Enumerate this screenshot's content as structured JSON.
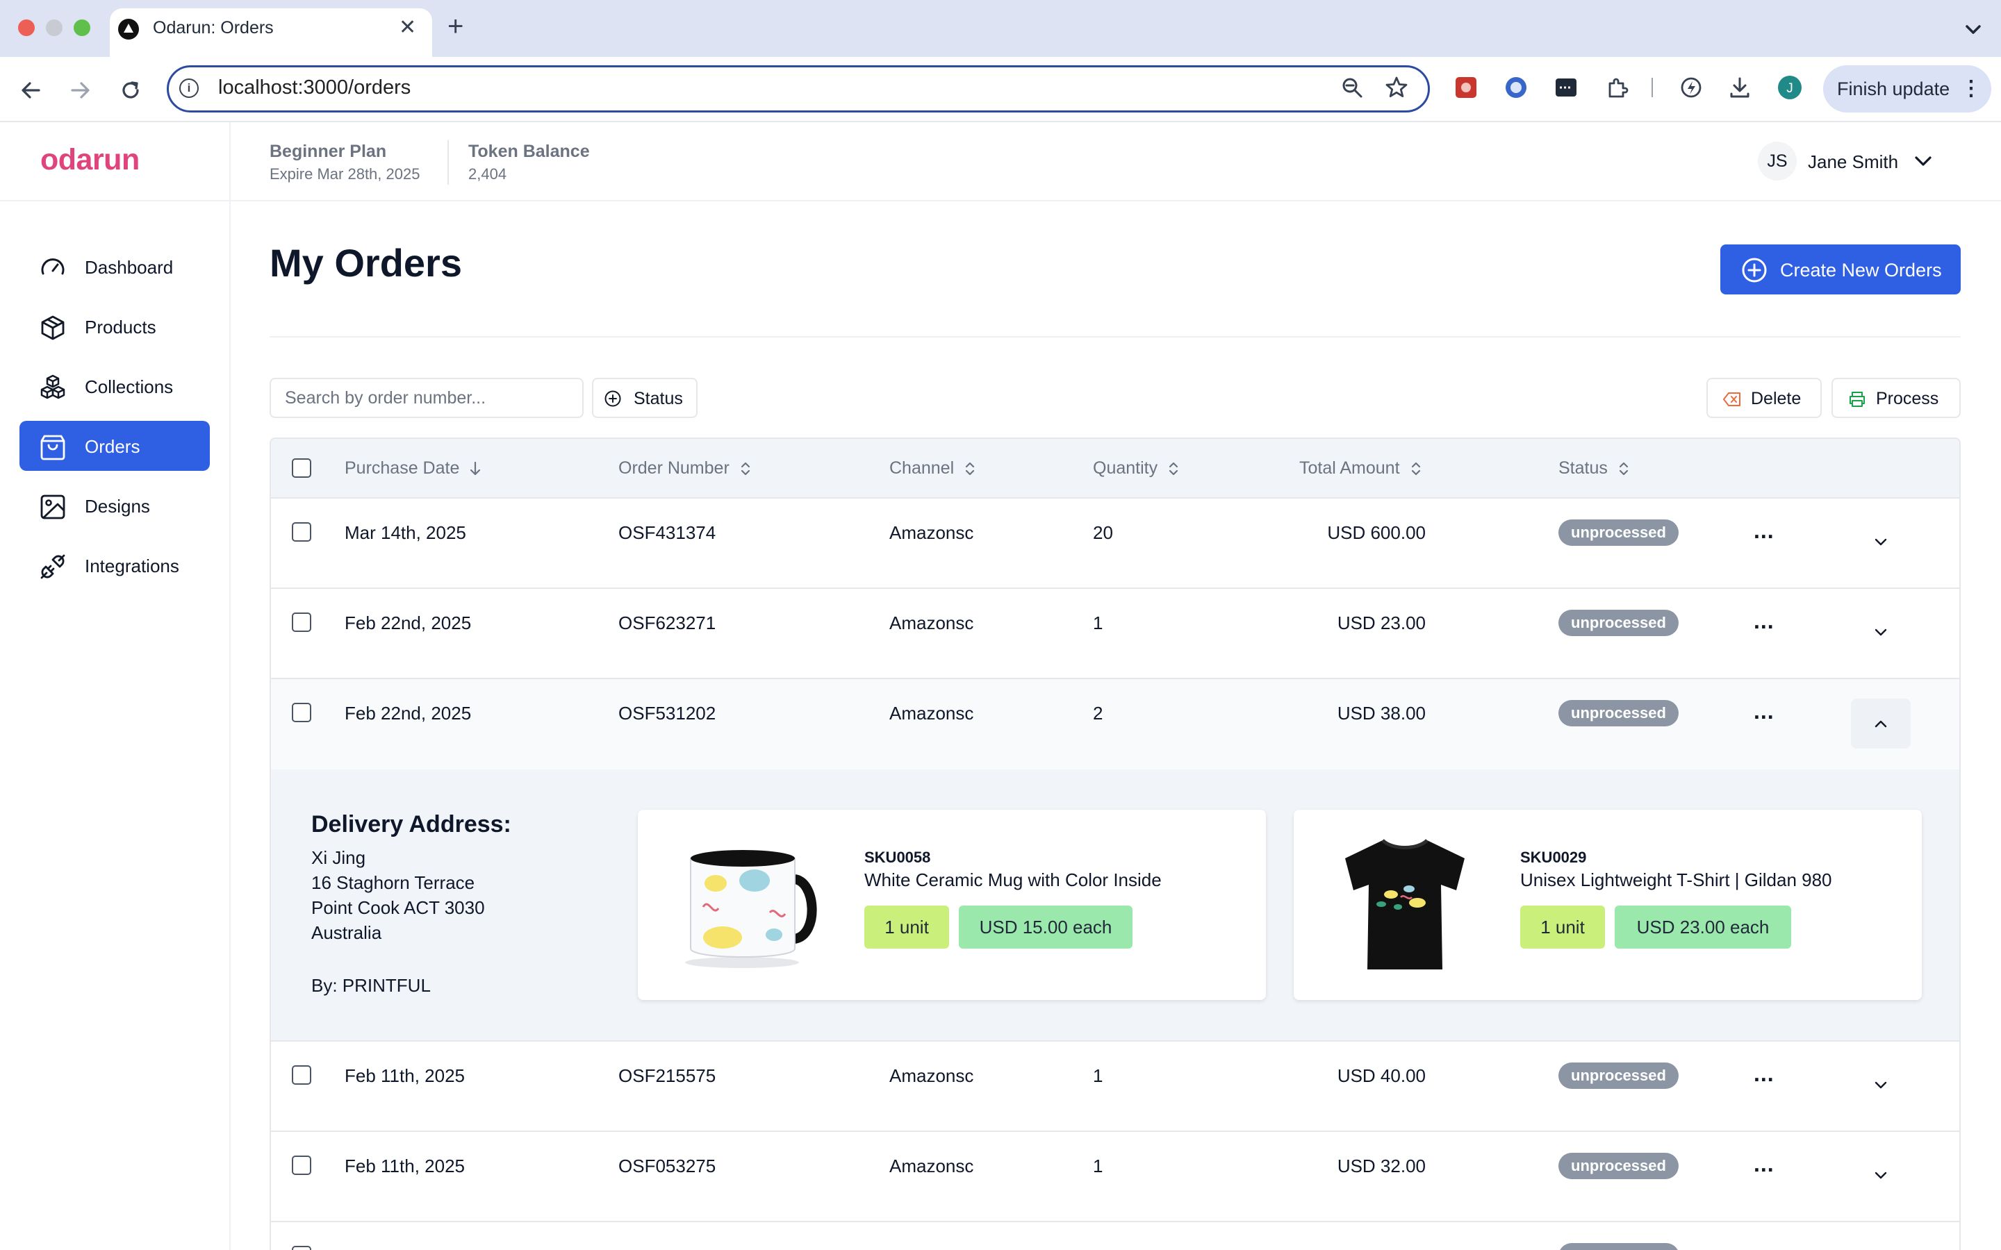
{
  "browser": {
    "tab_title": "Odarun: Orders",
    "tab_close": "✕",
    "tab_new": "+",
    "url": "localhost:3000/orders",
    "finish_update": "Finish update",
    "finish_menu": "⋮",
    "profile_initial": "J"
  },
  "app": {
    "logo": "odarun",
    "plan_name": "Beginner Plan",
    "plan_expire": "Expire Mar 28th, 2025",
    "token_label": "Token Balance",
    "token_value": "2,404",
    "user_initials": "JS",
    "user_name": "Jane Smith"
  },
  "sidebar": {
    "items": [
      {
        "label": "Dashboard",
        "icon": "gauge-icon"
      },
      {
        "label": "Products",
        "icon": "box-icon"
      },
      {
        "label": "Collections",
        "icon": "boxes-icon"
      },
      {
        "label": "Orders",
        "icon": "shopping-bag-icon",
        "active": true
      },
      {
        "label": "Designs",
        "icon": "image-icon"
      },
      {
        "label": "Integrations",
        "icon": "plug-icon"
      }
    ]
  },
  "page": {
    "title": "My Orders",
    "create_label": "Create New Orders",
    "search_placeholder": "Search by order number...",
    "status_filter": "Status",
    "delete_label": "Delete",
    "process_label": "Process"
  },
  "table": {
    "headers": {
      "purchase_date": "Purchase Date",
      "order_number": "Order Number",
      "channel": "Channel",
      "quantity": "Quantity",
      "total_amount": "Total Amount",
      "status": "Status"
    },
    "row_actions": "...",
    "rows": [
      {
        "date": "Mar 14th, 2025",
        "order": "OSF431374",
        "channel": "Amazonsc",
        "qty": "20",
        "amount": "USD 600.00",
        "status": "unprocessed"
      },
      {
        "date": "Feb 22nd, 2025",
        "order": "OSF623271",
        "channel": "Amazonsc",
        "qty": "1",
        "amount": "USD 23.00",
        "status": "unprocessed"
      },
      {
        "date": "Feb 22nd, 2025",
        "order": "OSF531202",
        "channel": "Amazonsc",
        "qty": "2",
        "amount": "USD 38.00",
        "status": "unprocessed",
        "expanded": true
      },
      {
        "date": "Feb 11th, 2025",
        "order": "OSF215575",
        "channel": "Amazonsc",
        "qty": "1",
        "amount": "USD 40.00",
        "status": "unprocessed"
      },
      {
        "date": "Feb 11th, 2025",
        "order": "OSF053275",
        "channel": "Amazonsc",
        "qty": "1",
        "amount": "USD 32.00",
        "status": "unprocessed"
      }
    ]
  },
  "expanded": {
    "title": "Delivery Address:",
    "address_lines": [
      "Xi Jing",
      "16 Staghorn Terrace",
      "Point Cook ACT 3030",
      "Australia"
    ],
    "by": "By: PRINTFUL",
    "items": [
      {
        "sku": "SKU0058",
        "name": "White Ceramic Mug with Color Inside",
        "units": "1 unit",
        "price": "USD 15.00 each"
      },
      {
        "sku": "SKU0029",
        "name": "Unisex Lightweight T-Shirt | Gildan 980",
        "units": "1 unit",
        "price": "USD 23.00 each"
      }
    ]
  },
  "colors": {
    "brand": "#e0447c",
    "primary": "#2f5fe3",
    "badge": "#8b95a3",
    "units_pill": "#cbef7b",
    "price_pill": "#9be8ad"
  }
}
